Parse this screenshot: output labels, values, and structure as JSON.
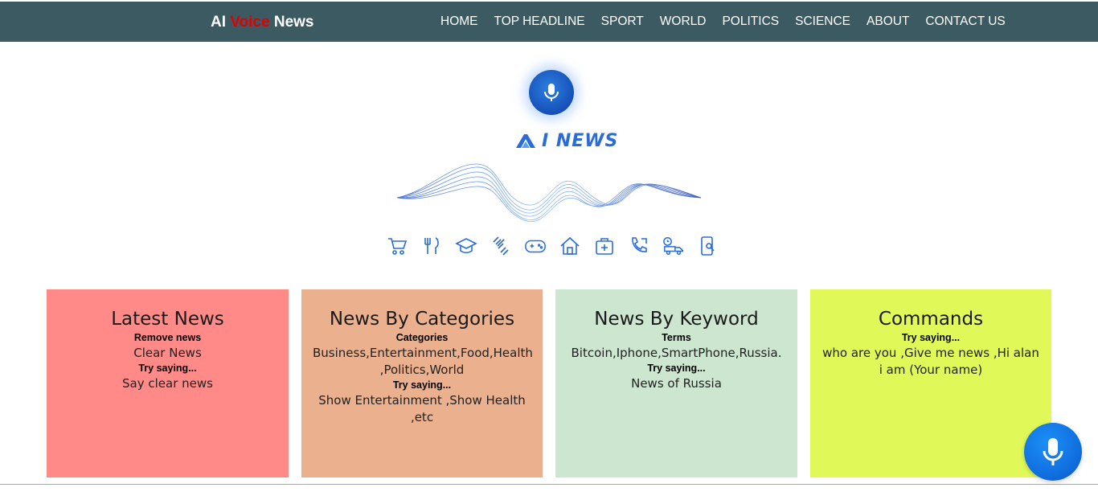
{
  "brand": {
    "part1": "AI ",
    "part2": "Voice",
    "part3": " News",
    "accent_color": "#e00000"
  },
  "nav": {
    "items": [
      {
        "label": "HOME"
      },
      {
        "label": "TOP HEADLINE"
      },
      {
        "label": "SPORT"
      },
      {
        "label": "WORLD"
      },
      {
        "label": "POLITICS"
      },
      {
        "label": "SCIENCE"
      },
      {
        "label": "ABOUT"
      },
      {
        "label": "CONTACT US"
      }
    ],
    "background": "#3c5a62"
  },
  "hero": {
    "logo_text": "I NEWS",
    "icons": [
      "cart-icon",
      "fork-knife-icon",
      "graduation-cap-icon",
      "dumbbell-icon",
      "gamepad-icon",
      "home-icon",
      "medical-kit-icon",
      "phone-icon",
      "delivery-truck-icon",
      "mobile-search-icon"
    ]
  },
  "cards": [
    {
      "title": "Latest News",
      "label1": "Remove news",
      "text1": "Clear News",
      "label2": "Try saying...",
      "text2": "Say clear news",
      "color": "#ff8a87"
    },
    {
      "title": "News By Categories",
      "label1": "Categories",
      "text1": "Business,Entertainment,Food,Health ,Politics,World",
      "label2": "Try saying...",
      "text2": "Show Entertainment ,Show Health ,etc",
      "color": "#ebb08d"
    },
    {
      "title": "News By Keyword",
      "label1": "Terms",
      "text1": "Bitcoin,Iphone,SmartPhone,Russia.",
      "label2": "Try saying...",
      "text2": "News of Russia",
      "color": "#cde6d0"
    },
    {
      "title": "Commands",
      "label1": "Try saying...",
      "text1": "who are you ,Give me news ,Hi alan i am (Your name)",
      "color": "#e0f958"
    }
  ],
  "fab": {
    "icon": "microphone-icon",
    "color": "#1170e0"
  }
}
